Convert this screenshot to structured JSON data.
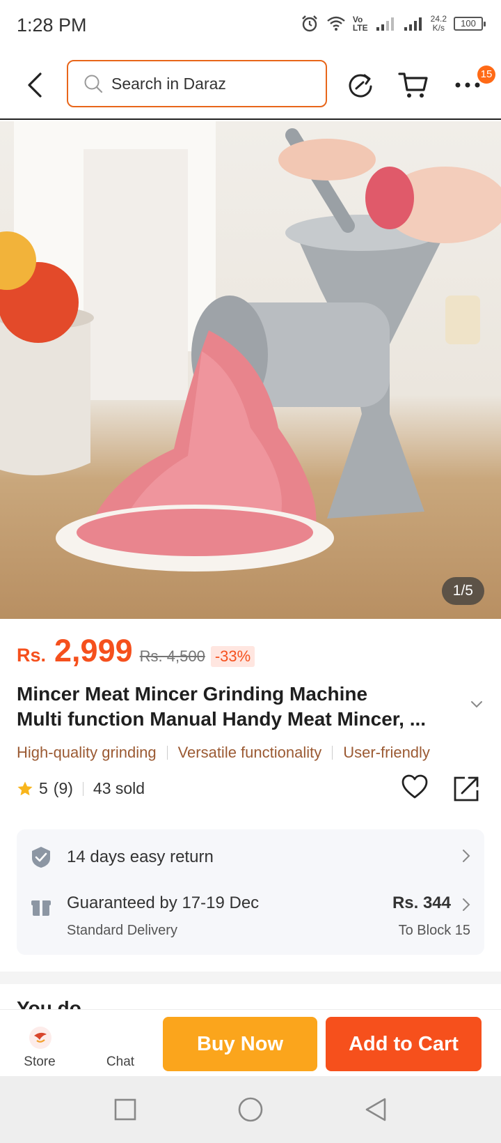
{
  "status_bar": {
    "time": "1:28 PM",
    "net_speed_value": "24.2",
    "net_speed_unit": "K/s",
    "volte_top": "Vo",
    "volte_bottom": "LTE",
    "battery": "100"
  },
  "header": {
    "search_placeholder": "Search in Daraz",
    "menu_badge": "15"
  },
  "gallery": {
    "counter": "1/5"
  },
  "product": {
    "currency": "Rs.",
    "price": "2,999",
    "original_price": "Rs. 4,500",
    "discount": "-33%",
    "title_line1": "Mincer Meat Mincer Grinding Machine",
    "title_line2": "Multi function Manual Handy Meat Mincer, ...",
    "features": [
      "High-quality grinding",
      "Versatile functionality",
      "User-friendly"
    ],
    "rating": "5",
    "rating_count": "(9)",
    "sold": "43 sold"
  },
  "services": {
    "return_text": "14 days easy return",
    "delivery_title": "Guaranteed by 17-19 Dec",
    "delivery_type": "Standard Delivery",
    "delivery_price": "Rs. 344",
    "delivery_destination": "To Block 15"
  },
  "next_section_title": "You do",
  "action_bar": {
    "store_label": "Store",
    "chat_label": "Chat",
    "buy_now_label": "Buy Now",
    "add_to_cart_label": "Add to Cart"
  },
  "colors": {
    "accent": "#f5501d",
    "buy_now": "#fba51c",
    "add_to_cart": "#f6501c"
  }
}
